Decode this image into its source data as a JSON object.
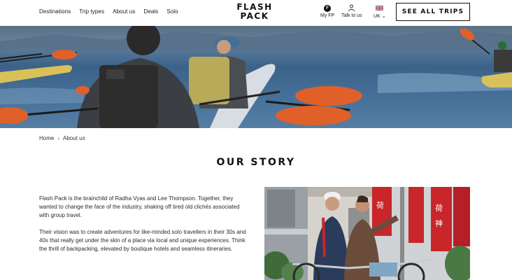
{
  "header": {
    "nav": [
      "Destinations",
      "Trip types",
      "About us",
      "Deals",
      "Solo"
    ],
    "logo_line1": "FLASH",
    "logo_line2": "PACK",
    "my_fp": "My FP",
    "my_fp_icon_letter": "F",
    "talk": "Talk to us",
    "region": "UK",
    "region_chevron": "⌄",
    "cta": "SEE ALL TRIPS"
  },
  "breadcrumb": {
    "home": "Home",
    "separator": "›",
    "current": "About us"
  },
  "page_title": "OUR STORY",
  "paragraphs": [
    "Flash Pack is the brainchild of Radha Vyas and Lee Thompson. Together, they wanted to change the face of the industry, shaking off tired old clichés associated with group travel.",
    "Their vision was to create adventures for like-minded solo travellers in their 30s and 40s that really get under the skin of a place via local and unique experiences. Think the thrill of backpacking, elevated by boutique hotels and seamless itineraries."
  ],
  "colors": {
    "paddle_orange": "#e0602a",
    "kayak_yellow": "#d9c15a",
    "banner_red": "#c8262a",
    "jacket_navy": "#2b3b5c"
  },
  "images": {
    "hero": "kayakers-on-lake",
    "story_photo": "founders-on-bicycles"
  }
}
